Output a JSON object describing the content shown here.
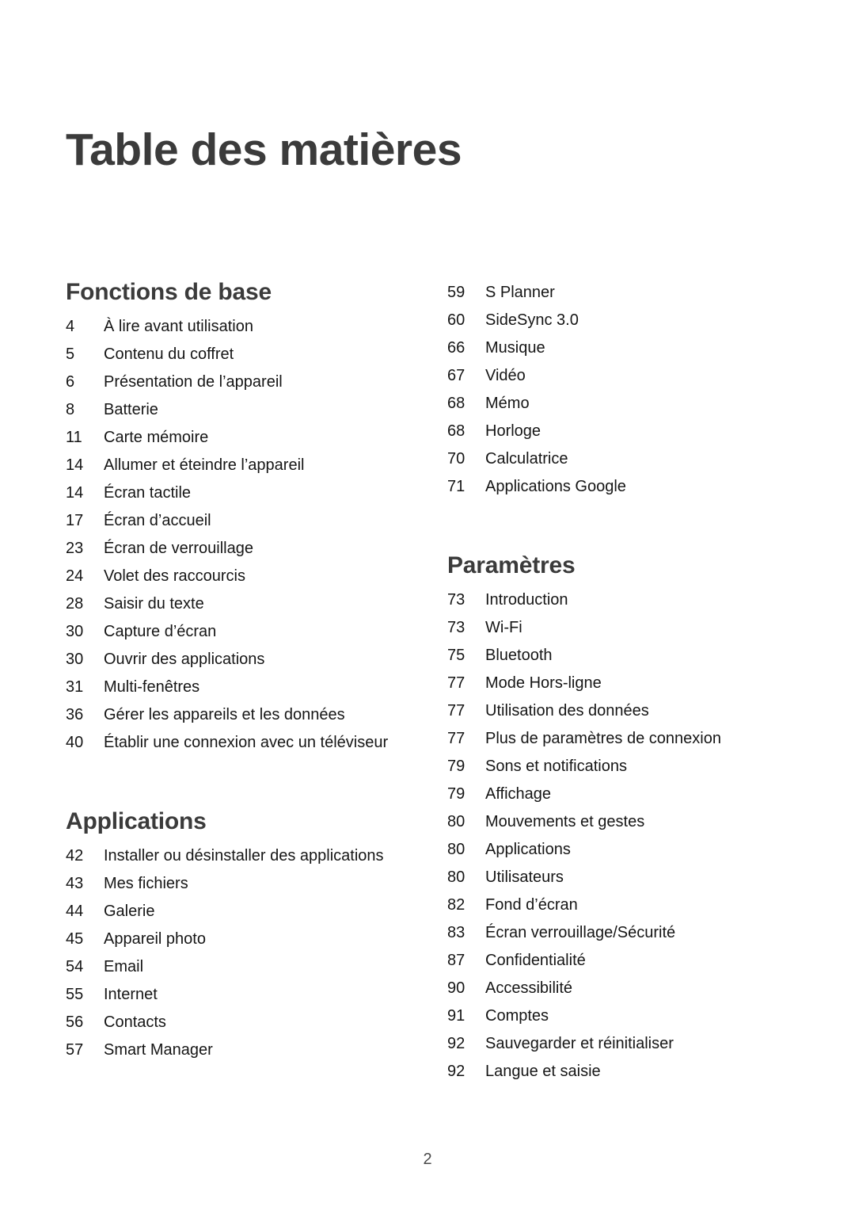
{
  "document": {
    "title": "Table des matières",
    "page_number": "2"
  },
  "colors": {
    "heading": "#3b3b3b",
    "body_text": "#161616",
    "background": "#ffffff",
    "folio": "#4a4a4a"
  },
  "columns": {
    "left": [
      {
        "heading": "Fonctions de base",
        "has_heading": true,
        "entries": [
          {
            "page": "4",
            "label": "À lire avant utilisation"
          },
          {
            "page": "5",
            "label": "Contenu du coffret"
          },
          {
            "page": "6",
            "label": "Présentation de l’appareil"
          },
          {
            "page": "8",
            "label": "Batterie"
          },
          {
            "page": "11",
            "label": "Carte mémoire"
          },
          {
            "page": "14",
            "label": "Allumer et éteindre l’appareil"
          },
          {
            "page": "14",
            "label": "Écran tactile"
          },
          {
            "page": "17",
            "label": "Écran d’accueil"
          },
          {
            "page": "23",
            "label": "Écran de verrouillage"
          },
          {
            "page": "24",
            "label": "Volet des raccourcis"
          },
          {
            "page": "28",
            "label": "Saisir du texte"
          },
          {
            "page": "30",
            "label": "Capture d’écran"
          },
          {
            "page": "30",
            "label": "Ouvrir des applications"
          },
          {
            "page": "31",
            "label": "Multi-fenêtres"
          },
          {
            "page": "36",
            "label": "Gérer les appareils et les données"
          },
          {
            "page": "40",
            "label": "Établir une connexion avec un téléviseur"
          }
        ]
      },
      {
        "heading": "Applications",
        "has_heading": true,
        "entries": [
          {
            "page": "42",
            "label": "Installer ou désinstaller des applications"
          },
          {
            "page": "43",
            "label": "Mes fichiers"
          },
          {
            "page": "44",
            "label": "Galerie"
          },
          {
            "page": "45",
            "label": "Appareil photo"
          },
          {
            "page": "54",
            "label": "Email"
          },
          {
            "page": "55",
            "label": "Internet"
          },
          {
            "page": "56",
            "label": "Contacts"
          },
          {
            "page": "57",
            "label": "Smart Manager"
          }
        ]
      }
    ],
    "right": [
      {
        "heading": "",
        "has_heading": false,
        "entries": [
          {
            "page": "59",
            "label": "S Planner"
          },
          {
            "page": "60",
            "label": "SideSync 3.0"
          },
          {
            "page": "66",
            "label": "Musique"
          },
          {
            "page": "67",
            "label": "Vidéo"
          },
          {
            "page": "68",
            "label": "Mémo"
          },
          {
            "page": "68",
            "label": "Horloge"
          },
          {
            "page": "70",
            "label": "Calculatrice"
          },
          {
            "page": "71",
            "label": "Applications Google"
          }
        ]
      },
      {
        "heading": "Paramètres",
        "has_heading": true,
        "entries": [
          {
            "page": "73",
            "label": "Introduction"
          },
          {
            "page": "73",
            "label": "Wi-Fi"
          },
          {
            "page": "75",
            "label": "Bluetooth"
          },
          {
            "page": "77",
            "label": "Mode Hors-ligne"
          },
          {
            "page": "77",
            "label": "Utilisation des données"
          },
          {
            "page": "77",
            "label": "Plus de paramètres de connexion"
          },
          {
            "page": "79",
            "label": "Sons et notifications"
          },
          {
            "page": "79",
            "label": "Affichage"
          },
          {
            "page": "80",
            "label": "Mouvements et gestes"
          },
          {
            "page": "80",
            "label": "Applications"
          },
          {
            "page": "80",
            "label": "Utilisateurs"
          },
          {
            "page": "82",
            "label": "Fond d’écran"
          },
          {
            "page": "83",
            "label": "Écran verrouillage/Sécurité"
          },
          {
            "page": "87",
            "label": "Confidentialité"
          },
          {
            "page": "90",
            "label": "Accessibilité"
          },
          {
            "page": "91",
            "label": "Comptes"
          },
          {
            "page": "92",
            "label": "Sauvegarder et réinitialiser"
          },
          {
            "page": "92",
            "label": "Langue et saisie"
          }
        ]
      }
    ]
  }
}
